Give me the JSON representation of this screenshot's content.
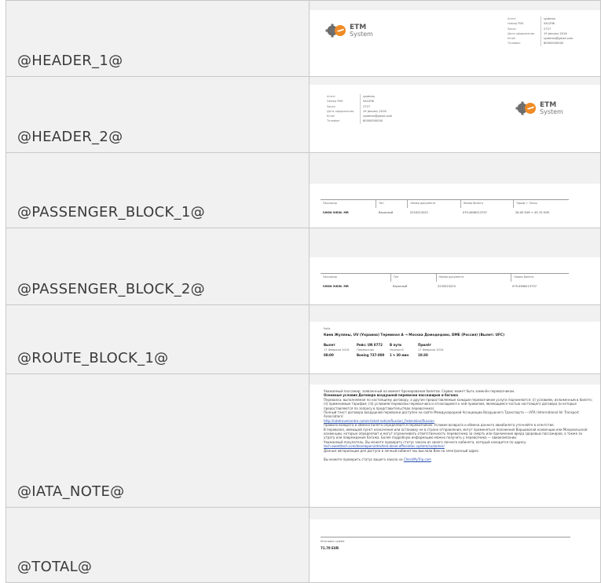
{
  "rows": [
    {
      "label": "@HEADER_1@"
    },
    {
      "label": "@HEADER_2@"
    },
    {
      "label": "@PASSENGER_BLOCK_1@"
    },
    {
      "label": "@PASSENGER_BLOCK_2@"
    },
    {
      "label": "@ROUTE_BLOCK_1@"
    },
    {
      "label": "@IATA_NOTE@"
    },
    {
      "label": "@TOTAL@"
    }
  ],
  "logo": {
    "line1": "ETM",
    "line2": "System"
  },
  "agency": {
    "keys": [
      "Агент",
      "Номер PNR",
      "Заказ",
      "Дата оформления",
      "Email",
      "Телефон"
    ],
    "values": [
      "systems",
      "5A1Z9K",
      "2727",
      "19 January 2016",
      "systems@gmail.com",
      "80000000000"
    ]
  },
  "passenger1": {
    "headers": [
      "Пассажир",
      "Тип",
      "Номер документа",
      "Номер билета",
      "Тариф + Таксы"
    ],
    "values": [
      "IVKIN IVKIN. MR",
      "Взрослый",
      "2233223223",
      "079-4636213757",
      "26.00 EUR + 45.70 EUR"
    ]
  },
  "passenger2": {
    "headers": [
      "Пассажир",
      "Тип",
      "Номер документа",
      "Номер билета"
    ],
    "values": [
      "IVKIN IVKIN. MR",
      "Взрослый",
      "2233223223",
      "079-4636213757"
    ]
  },
  "route": {
    "label": "Рейс",
    "title": "Киев Жуляны, UV (Украина) Терминал A → Москва Домодедово, DME (Россия) (Вылет: UFC)",
    "cols": [
      {
        "h": "Вылет",
        "l1": "17 Февраля 2016",
        "l2": "08:00"
      },
      {
        "h": "Рейс: UN 0772",
        "l1": "Перевозчик",
        "l2": "Boeing 737-800"
      },
      {
        "h": "В пути",
        "l1": "Эконом B",
        "l2": "1 ч 30 мин"
      },
      {
        "h": "Прилёт",
        "l1": "17 Февраля 2016",
        "l2": "10:30"
      }
    ]
  },
  "iata": {
    "intro": "Уважаемый пассажир, заявленный на момент бронирования билетов. Сервис может быть заменён перевозчиком.",
    "heading": "Основные условия Договора воздушной перевозки пассажиров и багажа",
    "p1": "Перевозка, выполняемая по настоящему договору, а другие предоставляемые каждым перевозчиком услуги подчиняются: (i) условиям, изложенным в билете; (ii) применимым тарифам; (iii) условиям перевозки перевозчика и относящимся к ней правилам, являющимся частью настоящего договора (и которые предоставляются по запросу в представительствах перевозчика).",
    "p2": "Полный текст договора воздушной перевозки доступен на сайте Международной Ассоциации Воздушного Транспорта — IATA (International Air Transport Association):",
    "link1": "http://iatatravelcentre.com/e-ticket-notice/Russian_Federation/Russian",
    "p3": "Правила возврата и обмена билета определяются перевозчиком. Условия возврата и обмена данного авиабилета уточняйте в агентстве.",
    "p4": "В перевозке, имеющей пункт назначения или остановку не в стране отправления, могут применяться положения Варшавской конвенции или Монреальской конвенции, которые определяют и могут ограничивать ответственность перевозчика за смерть или причинение вреда здоровью пассажиров, а также за утрату или повреждение багажа. Более подробную информацию можно получить у перевозчика — авиакомпании.",
    "p5": "Уважаемый покупатель. Вы можете проверить статус заказа из своего личного кабинета, который находится по адресу",
    "link2": "tech.sweettech.com/developers/etm/test.devel.officeintec.system/customer/",
    "p6": "Данные авторизации для доступа в личный кабинет мы выслали Вам на электронный адрес.",
    "p7": "Вы можете проверить статус вашего заказа на",
    "link3": "CheckMyTrip.com"
  },
  "total": {
    "label": "Итоговая сумма",
    "value": "71.70 EUR"
  }
}
